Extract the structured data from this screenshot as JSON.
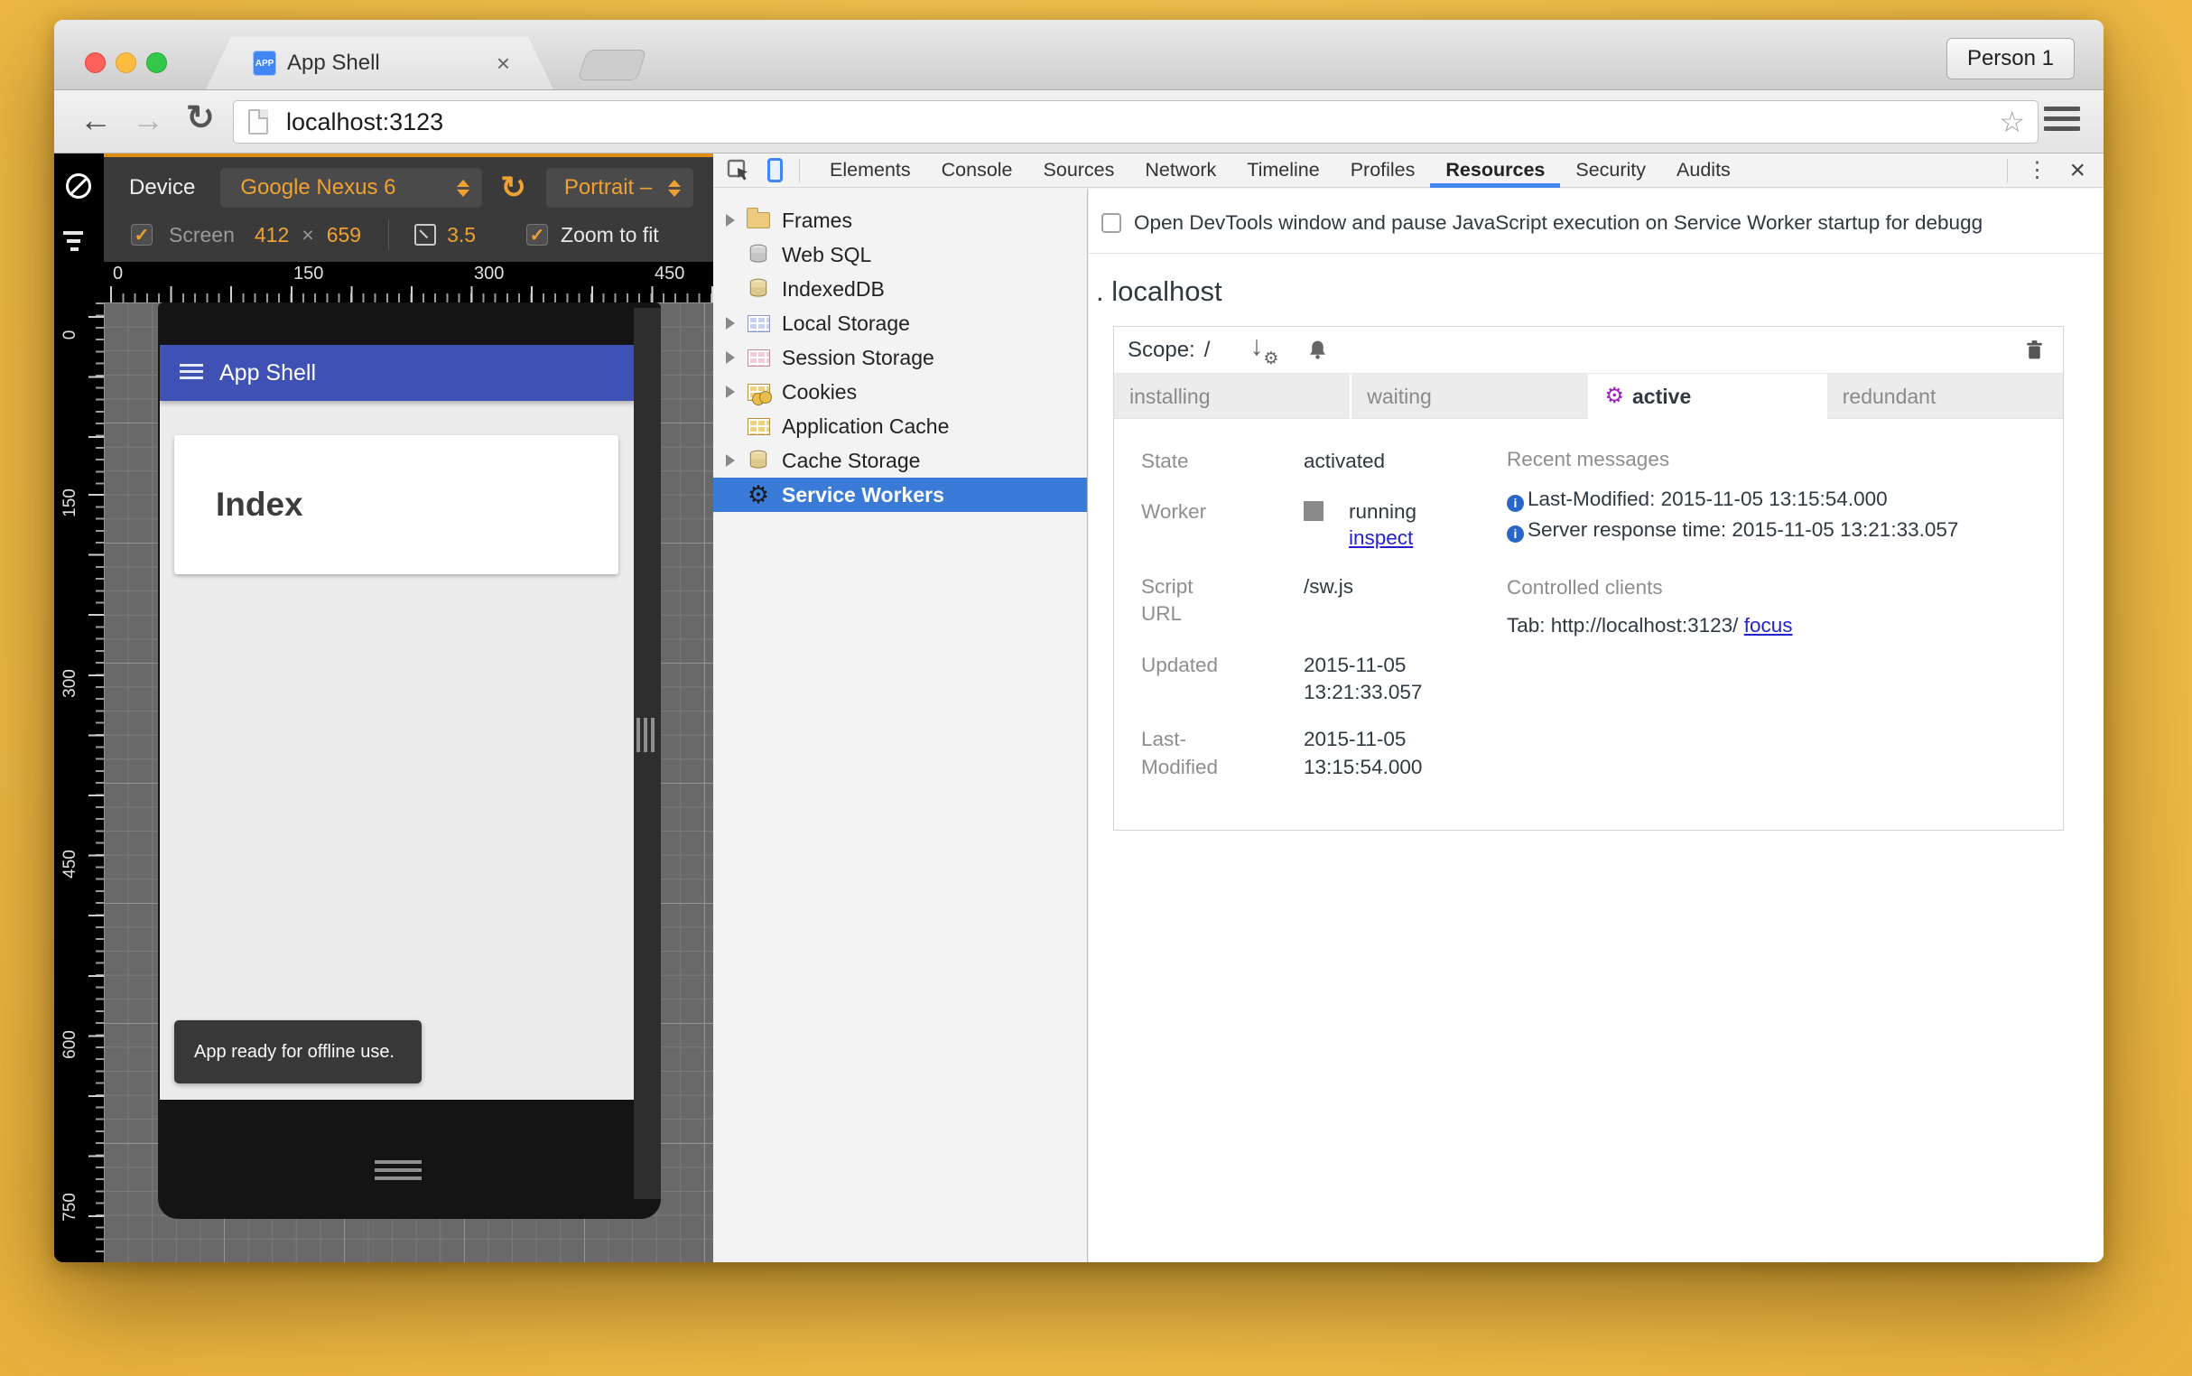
{
  "colors": {
    "accent_orange": "#EFA233",
    "app_header_blue": "#3F51B5",
    "selection_blue": "#3B7BD8",
    "tab_underline": "#4285F4",
    "gear_purple": "#A31BC4",
    "link_blue": "#2222CC"
  },
  "browser": {
    "tab_title": "App Shell",
    "favicon_text": "APP",
    "tab_close": "×",
    "profile_button": "Person 1",
    "url": "localhost:3123",
    "icons": {
      "back": "←",
      "forward": "→",
      "reload": "↻",
      "star": "☆",
      "kebab": "⋮",
      "close": "×"
    }
  },
  "device_toolbar": {
    "device_label": "Device",
    "device_value": "Google Nexus 6",
    "rotate_icon": "↻",
    "orientation_value": "Portrait –",
    "screen_check": "✓",
    "screen_label": "Screen",
    "screen_width": "412",
    "screen_times": "×",
    "screen_height": "659",
    "dpr": "3.5",
    "zoom_check": "✓",
    "zoom_label": "Zoom to fit"
  },
  "rulers": {
    "horizontal": [
      "0",
      "150",
      "300",
      "450"
    ],
    "vertical": [
      "0",
      "150",
      "300",
      "450",
      "600",
      "750"
    ]
  },
  "device_page": {
    "header_title": "App Shell",
    "card_title": "Index",
    "toast": "App ready for offline use."
  },
  "devtools": {
    "tabs": [
      "Elements",
      "Console",
      "Sources",
      "Network",
      "Timeline",
      "Profiles",
      "Resources",
      "Security",
      "Audits"
    ],
    "selected_tab": "Resources",
    "kebab": "⋮",
    "close": "×",
    "sidebar": [
      {
        "label": "Frames"
      },
      {
        "label": "Web SQL"
      },
      {
        "label": "IndexedDB"
      },
      {
        "label": "Local Storage"
      },
      {
        "label": "Session Storage"
      },
      {
        "label": "Cookies"
      },
      {
        "label": "Application Cache"
      },
      {
        "label": "Cache Storage"
      },
      {
        "label": "Service Workers"
      }
    ],
    "selected_sidebar": "Service Workers",
    "sw": {
      "debug_checkbox_label": "Open DevTools window and pause JavaScript execution on Service Worker startup for debugg",
      "origin_prefix": ".",
      "origin": "localhost",
      "scope_label": "Scope:",
      "scope_value": "/",
      "gear_glyph": "⚙",
      "update_arrow": "↓",
      "lifecycle_tabs": [
        "installing",
        "waiting",
        "active",
        "redundant"
      ],
      "active_lifecycle_tab": "active",
      "state_label": "State",
      "state_value": "activated",
      "worker_label": "Worker",
      "worker_status": "running",
      "worker_inspect": "inspect",
      "script_label": "Script URL",
      "script_value": "/sw.js",
      "updated_label": "Updated",
      "updated_value": "2015-11-05 13:21:33.057",
      "lastmod_label": "Last-Modified",
      "lastmod_value": "2015-11-05 13:15:54.000",
      "recent_heading": "Recent messages",
      "messages": [
        "Last-Modified: 2015-11-05 13:15:54.000",
        "Server response time: 2015-11-05 13:21:33.057"
      ],
      "info_glyph": "i",
      "clients_heading": "Controlled clients",
      "client_text": "Tab: http://localhost:3123/",
      "client_link": "focus"
    }
  }
}
